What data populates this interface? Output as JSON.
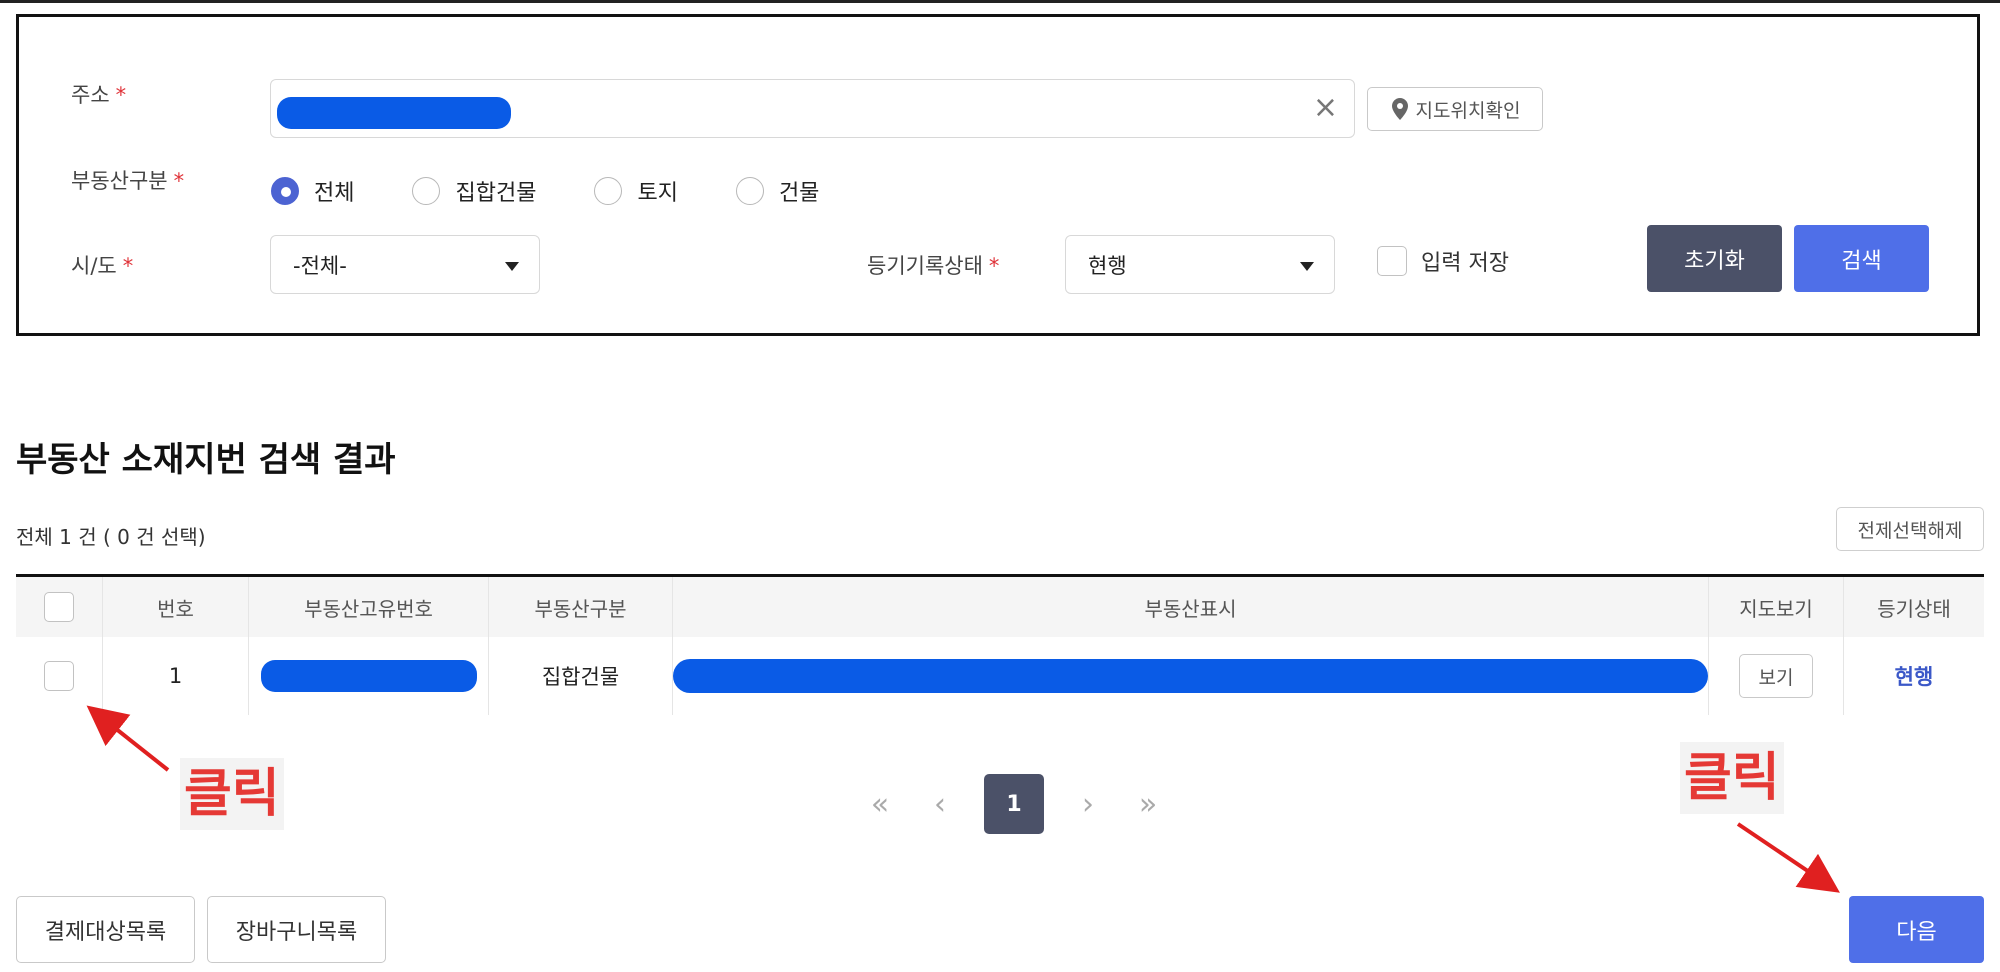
{
  "search_form": {
    "address": {
      "label": "주소",
      "required_mark": "*",
      "value": "",
      "clear_icon": "×"
    },
    "map_button": {
      "label": "지도위치확인",
      "icon": "map-pin-icon"
    },
    "property_type": {
      "label": "부동산구분",
      "required_mark": "*",
      "options": [
        "전체",
        "집합건물",
        "토지",
        "건물"
      ],
      "selected": "전체"
    },
    "region": {
      "label": "시/도",
      "required_mark": "*",
      "value": "-전체-"
    },
    "registry_status": {
      "label": "등기기록상태",
      "required_mark": "*",
      "value": "현행"
    },
    "save_input": {
      "label": "입력 저장",
      "checked": false
    },
    "reset_button": "초기화",
    "search_button": "검색"
  },
  "results": {
    "title": "부동산 소재지번 검색 결과",
    "count_text": "전체 1 건 ( 0 건 선택)",
    "deselect_all_button": "전제선택해제",
    "columns": [
      "번호",
      "부동산고유번호",
      "부동산구분",
      "부동산표시",
      "지도보기",
      "등기상태"
    ],
    "rows": [
      {
        "number": "1",
        "unique_id": "",
        "type": "집합건물",
        "display": "",
        "map_button": "보기",
        "status": "현행"
      }
    ]
  },
  "pagination": {
    "current": "1",
    "first_icon": "«",
    "prev_icon": "‹",
    "next_icon": "›",
    "last_icon": "»"
  },
  "bottom": {
    "payment_list_button": "결제대상목록",
    "cart_list_button": "장바구니목록",
    "next_button": "다음"
  },
  "annotations": {
    "left": "클릭",
    "right": "클릭"
  },
  "colors": {
    "primary": "#4f6fe8",
    "dark_button": "#4b5168",
    "required": "#e0343a",
    "annotation": "#e53935",
    "redaction": "#0a5be6"
  }
}
